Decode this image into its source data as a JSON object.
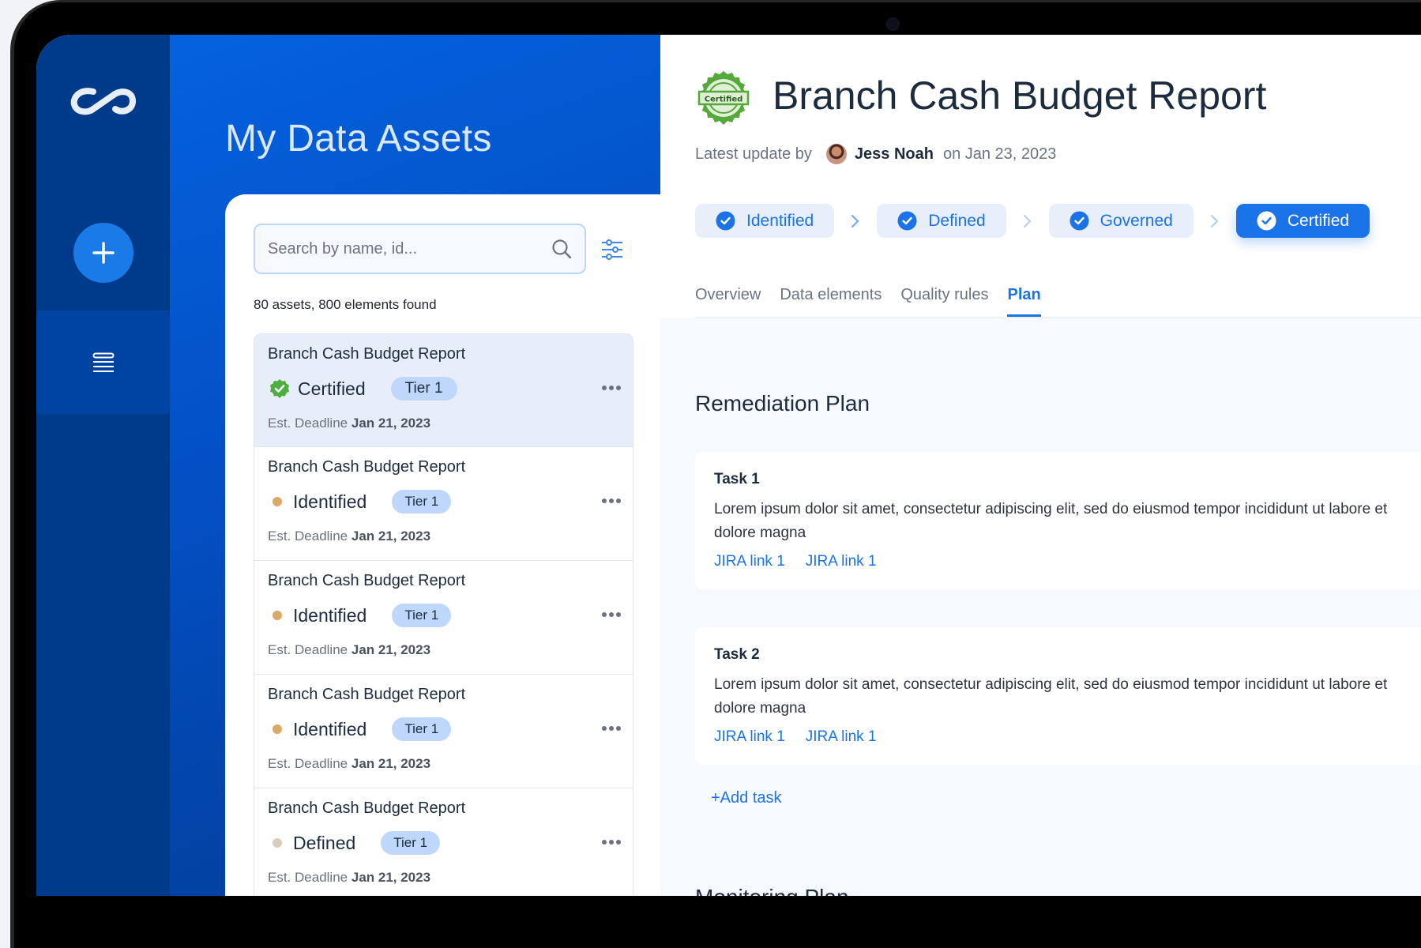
{
  "sidebar": {
    "logo_icon": "infinity-logo-icon",
    "add_icon": "plus-icon",
    "list_icon": "list-stack-icon"
  },
  "list": {
    "title": "My Data Assets",
    "search_placeholder": "Search by name, id...",
    "search_value": "",
    "count_text": "80 assets, 800 elements found",
    "deadline_label": "Est. Deadline",
    "items": [
      {
        "title": "Branch Cash Budget Report",
        "status": "Certified",
        "status_kind": "certified",
        "tier": "Tier 1",
        "deadline": "Jan 21, 2023",
        "selected": true
      },
      {
        "title": "Branch Cash Budget Report",
        "status": "Identified",
        "status_kind": "identified",
        "tier": "Tier 1",
        "deadline": "Jan 21, 2023"
      },
      {
        "title": "Branch Cash Budget Report",
        "status": "Identified",
        "status_kind": "identified",
        "tier": "Tier 1",
        "deadline": "Jan 21, 2023"
      },
      {
        "title": "Branch Cash Budget Report",
        "status": "Identified",
        "status_kind": "identified",
        "tier": "Tier 1",
        "deadline": "Jan 21, 2023"
      },
      {
        "title": "Branch Cash Budget Report",
        "status": "Defined",
        "status_kind": "defined",
        "tier": "Tier 1",
        "deadline": "Jan 21, 2023"
      }
    ]
  },
  "colors": {
    "accent": "#1a73e8",
    "certified_green": "#4caf3f",
    "identified_dot": "#dba867",
    "defined_dot": "#d8cdb8",
    "sidebar": "#003a8a"
  },
  "detail": {
    "badge_text": "Certified",
    "title": "Branch Cash Budget Report",
    "meta_prefix": "Latest update by",
    "author": "Jess Noah",
    "meta_suffix": "on Jan 23, 2023",
    "stages": [
      {
        "label": "Identified",
        "active": false
      },
      {
        "label": "Defined",
        "active": false
      },
      {
        "label": "Governed",
        "active": false
      },
      {
        "label": "Certified",
        "active": true
      }
    ],
    "tabs": [
      {
        "label": "Overview",
        "active": false
      },
      {
        "label": "Data elements",
        "active": false
      },
      {
        "label": "Quality rules",
        "active": false
      },
      {
        "label": "Plan",
        "active": true
      }
    ],
    "remediation": {
      "title": "Remediation Plan",
      "tasks": [
        {
          "title": "Task 1",
          "desc": "Lorem ipsum dolor sit amet, consectetur adipiscing elit, sed do eiusmod tempor incididunt ut labore et dolore magna",
          "links": [
            "JIRA link 1",
            "JIRA link 1"
          ]
        },
        {
          "title": "Task 2",
          "desc": "Lorem ipsum dolor sit amet, consectetur adipiscing elit, sed do eiusmod tempor incididunt ut labore et dolore magna",
          "links": [
            "JIRA link 1",
            "JIRA link 1"
          ]
        }
      ],
      "add_label": "+Add task"
    },
    "monitoring": {
      "title": "Monitoring Plan"
    }
  }
}
